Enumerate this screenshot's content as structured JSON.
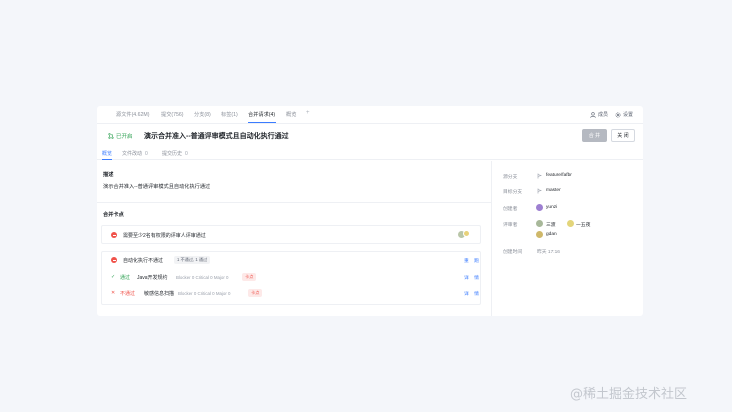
{
  "nav": {
    "tabs": [
      {
        "label": "源文件(4.62M)"
      },
      {
        "label": "提交(756)"
      },
      {
        "label": "分支(8)"
      },
      {
        "label": "标签(1)"
      },
      {
        "label": "合并请求(4)"
      },
      {
        "label": "概览"
      }
    ],
    "plus": "+",
    "members_label": "成员",
    "settings_label": "设置"
  },
  "mr": {
    "status": "已开启",
    "title": "演示合并准入--普通评审模式且自动化执行通过",
    "merge_button": "合 并",
    "close_button": "关 闭"
  },
  "subtabs": [
    {
      "label": "概览",
      "count": ""
    },
    {
      "label": "文件改动",
      "count": "0"
    },
    {
      "label": "提交历史",
      "count": "0"
    }
  ],
  "description": {
    "heading": "描述",
    "text": "演示合并准入--普通评审模式且自动化执行通过"
  },
  "checkpoints": {
    "heading": "合并卡点",
    "review_rule": "需要至少2名有权限的评审人评审通过",
    "automation": {
      "title": "自动化执行不通过",
      "summary": "1 不通过, 1 通过",
      "link": "重 跑",
      "items": [
        {
          "status": "通过",
          "name": "Java开发规约",
          "metrics": "Blocker 0 Critical 0 Major 0",
          "tag": "卡点",
          "link": "详 情"
        },
        {
          "status": "不通过",
          "name": "敏感信息扫描",
          "metrics": "Blocker 0 Critical 0 Major 0",
          "tag": "卡点",
          "link": "详 情"
        }
      ]
    }
  },
  "sidebar": {
    "source_branch_label": "源分支",
    "source_branch": "feature/fafbr",
    "target_branch_label": "目标分支",
    "target_branch": "master",
    "creator_label": "创建者",
    "creator": "yunzi",
    "reviewers_label": "评审者",
    "reviewers": [
      "三渡",
      "一五夜",
      "gdan"
    ],
    "created_label": "创建时间",
    "created_time": "昨天 17:16"
  },
  "watermark": "@稀土掘金技术社区",
  "colors": {
    "accent": "#3b7cff",
    "success": "#2ea152",
    "danger": "#f0524a",
    "background": "#f4f6fa"
  }
}
